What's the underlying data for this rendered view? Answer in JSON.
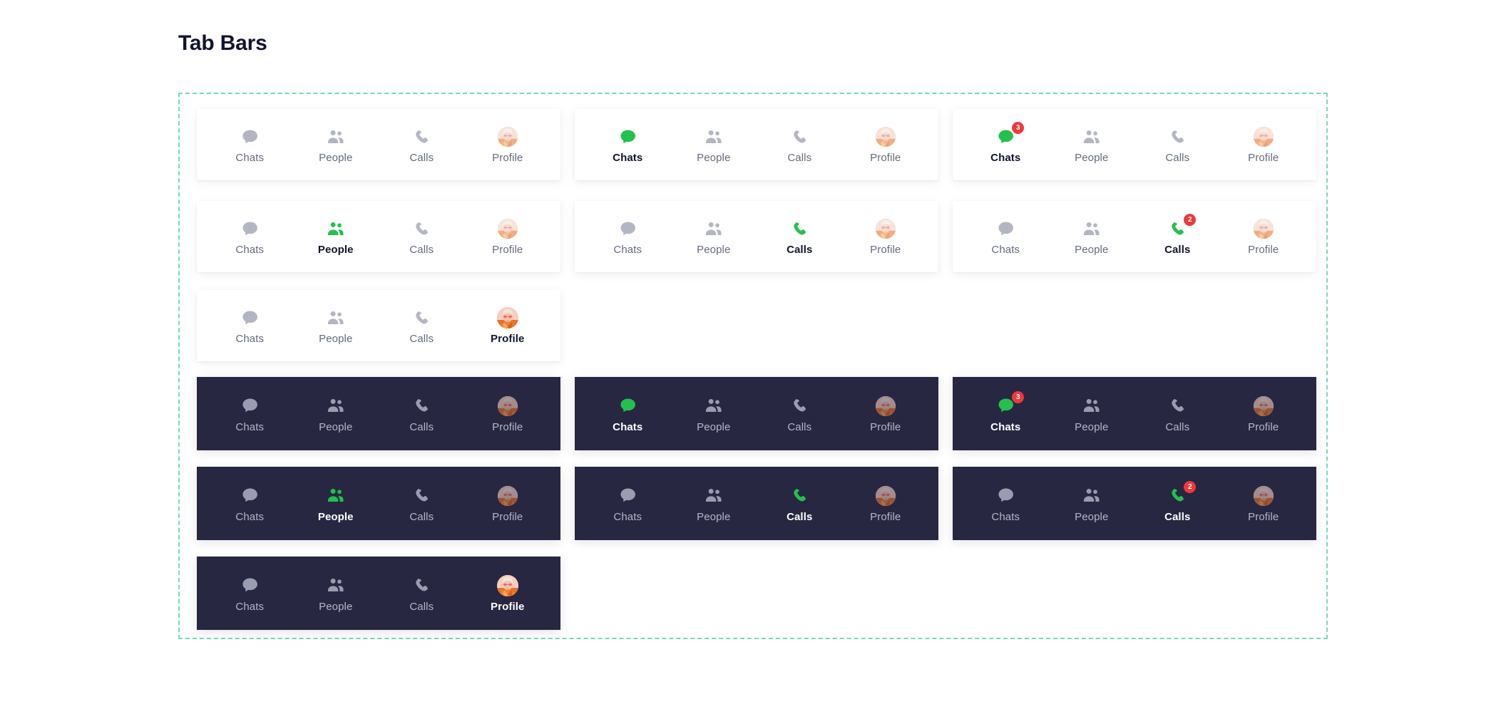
{
  "page": {
    "title": "Tab Bars",
    "accent_green": "#24c04e",
    "badge_red": "#ef3939",
    "dark_bar_bg": "#272742",
    "frame_border": "#6fdcb5",
    "inactive_icon": "#b3b6c2",
    "inactive_label": "#646a7d",
    "active_label": "#11142d"
  },
  "labels": {
    "chats": "Chats",
    "people": "People",
    "calls": "Calls",
    "profile": "Profile"
  },
  "badges": {
    "chats_count": "3",
    "calls_count": "2"
  },
  "bars": [
    {
      "id": "light-chats-none",
      "theme": "light",
      "active": "none",
      "column": 0,
      "row": 0,
      "tabs": [
        {
          "key": "chats",
          "label": "Chats",
          "icon": "chat-bubble-icon",
          "active": false,
          "badge": null
        },
        {
          "key": "people",
          "label": "People",
          "icon": "people-icon",
          "active": false,
          "badge": null
        },
        {
          "key": "calls",
          "label": "Calls",
          "icon": "phone-icon",
          "active": false,
          "badge": null
        },
        {
          "key": "profile",
          "label": "Profile",
          "icon": "avatar-icon",
          "active": false,
          "badge": null
        }
      ]
    },
    {
      "id": "light-chats-active",
      "theme": "light",
      "active": "chats",
      "column": 1,
      "row": 0,
      "tabs": [
        {
          "key": "chats",
          "label": "Chats",
          "icon": "chat-bubble-icon",
          "active": true,
          "badge": null
        },
        {
          "key": "people",
          "label": "People",
          "icon": "people-icon",
          "active": false,
          "badge": null
        },
        {
          "key": "calls",
          "label": "Calls",
          "icon": "phone-icon",
          "active": false,
          "badge": null
        },
        {
          "key": "profile",
          "label": "Profile",
          "icon": "avatar-icon",
          "active": false,
          "badge": null
        }
      ]
    },
    {
      "id": "light-chats-active-badge",
      "theme": "light",
      "active": "chats",
      "column": 2,
      "row": 0,
      "tabs": [
        {
          "key": "chats",
          "label": "Chats",
          "icon": "chat-bubble-icon",
          "active": true,
          "badge": "3"
        },
        {
          "key": "people",
          "label": "People",
          "icon": "people-icon",
          "active": false,
          "badge": null
        },
        {
          "key": "calls",
          "label": "Calls",
          "icon": "phone-icon",
          "active": false,
          "badge": null
        },
        {
          "key": "profile",
          "label": "Profile",
          "icon": "avatar-icon",
          "active": false,
          "badge": null
        }
      ]
    },
    {
      "id": "light-people-active",
      "theme": "light",
      "active": "people",
      "column": 0,
      "row": 1,
      "tabs": [
        {
          "key": "chats",
          "label": "Chats",
          "icon": "chat-bubble-icon",
          "active": false,
          "badge": null
        },
        {
          "key": "people",
          "label": "People",
          "icon": "people-icon",
          "active": true,
          "badge": null
        },
        {
          "key": "calls",
          "label": "Calls",
          "icon": "phone-icon",
          "active": false,
          "badge": null
        },
        {
          "key": "profile",
          "label": "Profile",
          "icon": "avatar-icon",
          "active": false,
          "badge": null
        }
      ]
    },
    {
      "id": "light-calls-active",
      "theme": "light",
      "active": "calls",
      "column": 1,
      "row": 1,
      "tabs": [
        {
          "key": "chats",
          "label": "Chats",
          "icon": "chat-bubble-icon",
          "active": false,
          "badge": null
        },
        {
          "key": "people",
          "label": "People",
          "icon": "people-icon",
          "active": false,
          "badge": null
        },
        {
          "key": "calls",
          "label": "Calls",
          "icon": "phone-icon",
          "active": true,
          "badge": null
        },
        {
          "key": "profile",
          "label": "Profile",
          "icon": "avatar-icon",
          "active": false,
          "badge": null
        }
      ]
    },
    {
      "id": "light-calls-active-badge",
      "theme": "light",
      "active": "calls",
      "column": 2,
      "row": 1,
      "tabs": [
        {
          "key": "chats",
          "label": "Chats",
          "icon": "chat-bubble-icon",
          "active": false,
          "badge": null
        },
        {
          "key": "people",
          "label": "People",
          "icon": "people-icon",
          "active": false,
          "badge": null
        },
        {
          "key": "calls",
          "label": "Calls",
          "icon": "phone-icon",
          "active": true,
          "badge": "2"
        },
        {
          "key": "profile",
          "label": "Profile",
          "icon": "avatar-icon",
          "active": false,
          "badge": null
        }
      ]
    },
    {
      "id": "light-profile-active",
      "theme": "light",
      "active": "profile",
      "column": 0,
      "row": 2,
      "tabs": [
        {
          "key": "chats",
          "label": "Chats",
          "icon": "chat-bubble-icon",
          "active": false,
          "badge": null
        },
        {
          "key": "people",
          "label": "People",
          "icon": "people-icon",
          "active": false,
          "badge": null
        },
        {
          "key": "calls",
          "label": "Calls",
          "icon": "phone-icon",
          "active": false,
          "badge": null
        },
        {
          "key": "profile",
          "label": "Profile",
          "icon": "avatar-icon",
          "active": true,
          "badge": null
        }
      ]
    },
    {
      "id": "dark-chats-none",
      "theme": "dark",
      "active": "none",
      "column": 0,
      "row": 3,
      "tabs": [
        {
          "key": "chats",
          "label": "Chats",
          "icon": "chat-bubble-icon",
          "active": false,
          "badge": null
        },
        {
          "key": "people",
          "label": "People",
          "icon": "people-icon",
          "active": false,
          "badge": null
        },
        {
          "key": "calls",
          "label": "Calls",
          "icon": "phone-icon",
          "active": false,
          "badge": null
        },
        {
          "key": "profile",
          "label": "Profile",
          "icon": "avatar-icon",
          "active": false,
          "badge": null
        }
      ]
    },
    {
      "id": "dark-chats-active",
      "theme": "dark",
      "active": "chats",
      "column": 1,
      "row": 3,
      "tabs": [
        {
          "key": "chats",
          "label": "Chats",
          "icon": "chat-bubble-icon",
          "active": true,
          "badge": null
        },
        {
          "key": "people",
          "label": "People",
          "icon": "people-icon",
          "active": false,
          "badge": null
        },
        {
          "key": "calls",
          "label": "Calls",
          "icon": "phone-icon",
          "active": false,
          "badge": null
        },
        {
          "key": "profile",
          "label": "Profile",
          "icon": "avatar-icon",
          "active": false,
          "badge": null
        }
      ]
    },
    {
      "id": "dark-chats-active-badge",
      "theme": "dark",
      "active": "chats",
      "column": 2,
      "row": 3,
      "tabs": [
        {
          "key": "chats",
          "label": "Chats",
          "icon": "chat-bubble-icon",
          "active": true,
          "badge": "3"
        },
        {
          "key": "people",
          "label": "People",
          "icon": "people-icon",
          "active": false,
          "badge": null
        },
        {
          "key": "calls",
          "label": "Calls",
          "icon": "phone-icon",
          "active": false,
          "badge": null
        },
        {
          "key": "profile",
          "label": "Profile",
          "icon": "avatar-icon",
          "active": false,
          "badge": null
        }
      ]
    },
    {
      "id": "dark-people-active",
      "theme": "dark",
      "active": "people",
      "column": 0,
      "row": 4,
      "tabs": [
        {
          "key": "chats",
          "label": "Chats",
          "icon": "chat-bubble-icon",
          "active": false,
          "badge": null
        },
        {
          "key": "people",
          "label": "People",
          "icon": "people-icon",
          "active": true,
          "badge": null
        },
        {
          "key": "calls",
          "label": "Calls",
          "icon": "phone-icon",
          "active": false,
          "badge": null
        },
        {
          "key": "profile",
          "label": "Profile",
          "icon": "avatar-icon",
          "active": false,
          "badge": null
        }
      ]
    },
    {
      "id": "dark-calls-active",
      "theme": "dark",
      "active": "calls",
      "column": 1,
      "row": 4,
      "tabs": [
        {
          "key": "chats",
          "label": "Chats",
          "icon": "chat-bubble-icon",
          "active": false,
          "badge": null
        },
        {
          "key": "people",
          "label": "People",
          "icon": "people-icon",
          "active": false,
          "badge": null
        },
        {
          "key": "calls",
          "label": "Calls",
          "icon": "phone-icon",
          "active": true,
          "badge": null
        },
        {
          "key": "profile",
          "label": "Profile",
          "icon": "avatar-icon",
          "active": false,
          "badge": null
        }
      ]
    },
    {
      "id": "dark-calls-active-badge",
      "theme": "dark",
      "active": "calls",
      "column": 2,
      "row": 4,
      "tabs": [
        {
          "key": "chats",
          "label": "Chats",
          "icon": "chat-bubble-icon",
          "active": false,
          "badge": null
        },
        {
          "key": "people",
          "label": "People",
          "icon": "people-icon",
          "active": false,
          "badge": null
        },
        {
          "key": "calls",
          "label": "Calls",
          "icon": "phone-icon",
          "active": true,
          "badge": "2"
        },
        {
          "key": "profile",
          "label": "Profile",
          "icon": "avatar-icon",
          "active": false,
          "badge": null
        }
      ]
    },
    {
      "id": "dark-profile-active",
      "theme": "dark",
      "active": "profile",
      "column": 0,
      "row": 5,
      "tabs": [
        {
          "key": "chats",
          "label": "Chats",
          "icon": "chat-bubble-icon",
          "active": false,
          "badge": null
        },
        {
          "key": "people",
          "label": "People",
          "icon": "people-icon",
          "active": false,
          "badge": null
        },
        {
          "key": "calls",
          "label": "Calls",
          "icon": "phone-icon",
          "active": false,
          "badge": null
        },
        {
          "key": "profile",
          "label": "Profile",
          "icon": "avatar-icon",
          "active": true,
          "badge": null
        }
      ]
    }
  ]
}
